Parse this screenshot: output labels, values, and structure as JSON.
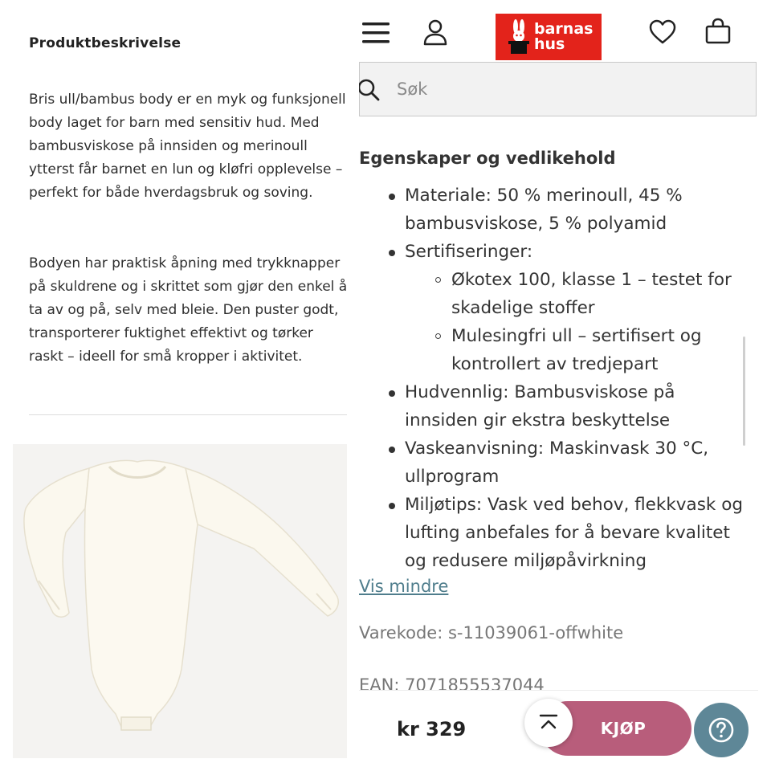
{
  "left": {
    "title": "Produktbeskrivelse",
    "paragraph1": "Bris ull/bambus body er en myk og funksjonell body laget for barn med sensitiv hud. Med bambusviskose på innsiden og merinoull ytterst får barnet en lun og kløfri opplevelse – perfekt for både hverdagsbruk og soving.",
    "paragraph2": "Bodyen har praktisk åpning med trykknapper på skuldrene og i skrittet som gjør den enkel å ta av og på, selv med bleie. Den puster godt, transporterer fuktighet effektivt og tørker raskt – ideell for små kropper i aktivitet."
  },
  "header": {
    "menu_icon": "hamburger-menu-icon",
    "account_icon": "user-icon",
    "wishlist_icon": "heart-icon",
    "cart_icon": "shopping-bag-icon",
    "logo_line1": "barnas",
    "logo_line2": "hus",
    "logo_color": "#e3231b"
  },
  "search": {
    "placeholder": "Søk",
    "icon": "search-icon"
  },
  "properties": {
    "title": "Egenskaper og vedlikehold",
    "material": "Materiale: 50 % merinoull, 45 % bambusviskose, 5 % polyamid",
    "certifications": "Sertifiseringer:",
    "cert_1": "Økotex 100, klasse 1 – testet for skadelige stoffer",
    "cert_2": "Mulesingfri ull – sertifisert og kontrollert av tredjepart",
    "skin": "Hudvennlig: Bambusviskose på innsiden gir ekstra beskyttelse",
    "wash": "Vaskeanvisning: Maskinvask 30 °C, ullprogram",
    "eco": "Miljøtips: Vask ved behov, flekkvask og lufting anbefales for å bevare kvalitet og redusere miljøpåvirkning"
  },
  "show_less": "Vis mindre",
  "sku": "Varekode: s-11039061-offwhite",
  "ean": "EAN: 7071855537044",
  "footer": {
    "price": "kr 329",
    "buy_label": "KJØP",
    "buy_color": "#b85d7b",
    "help_color": "#5e8797",
    "scroll_top_icon": "chevron-up-icon",
    "help_icon": "question-mark-icon"
  }
}
